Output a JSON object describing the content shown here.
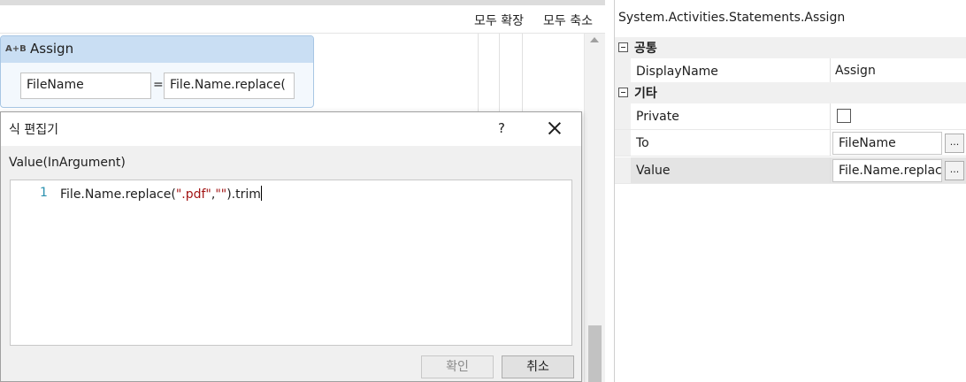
{
  "designer": {
    "expand_all": "모두 확장",
    "collapse_all": "모두 축소",
    "activity": {
      "icon_text": "A+B",
      "title": "Assign",
      "to_value": "FileName",
      "equals": "=",
      "value_preview": "File.Name.replace("
    }
  },
  "dialog": {
    "title": "식 편집기",
    "help": "?",
    "argument_label": "Value(InArgument)",
    "editor": {
      "line_number": "1",
      "code_prefix": "File.Name.replace(",
      "code_string1": "\".pdf\"",
      "code_comma": ",",
      "code_string2": "\"\"",
      "code_suffix": ").trim"
    },
    "ok_label": "확인",
    "cancel_label": "취소"
  },
  "properties": {
    "title": "System.Activities.Statements.Assign",
    "categories": [
      {
        "name": "공통",
        "rows": [
          {
            "name": "DisplayName",
            "value": "Assign"
          }
        ]
      },
      {
        "name": "기타",
        "rows": [
          {
            "name": "Private",
            "value": false
          },
          {
            "name": "To",
            "value": "FileName",
            "button": "..."
          },
          {
            "name": "Value",
            "value": "File.Name.replac",
            "button": "..."
          }
        ]
      }
    ]
  },
  "colors": {
    "activity_header": "#c9def3",
    "activity_border": "#a8c6e4",
    "line_number": "#2b91af",
    "string_literal": "#a31515"
  }
}
